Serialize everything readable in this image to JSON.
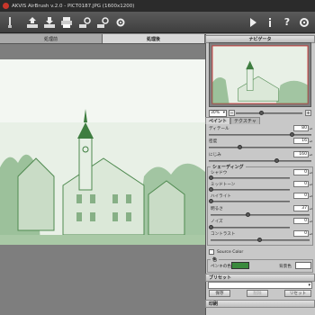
{
  "window": {
    "title": "AKVIS AirBrush v.2.0 - PICT0187.JPG (1600x1200)"
  },
  "toolbar": {
    "buttons": [
      "brush-tool",
      "open",
      "save",
      "print",
      "settings-a",
      "settings-b",
      "settings-c"
    ],
    "right_buttons": [
      "run",
      "about",
      "help",
      "settings"
    ]
  },
  "view_tabs": {
    "before": "処理前",
    "after": "処理後"
  },
  "navigator": {
    "title": "ナビゲータ",
    "zoom": "30%"
  },
  "settings": {
    "tab_paint": "ペイント",
    "tab_texture": "テクスチャ",
    "detail_label": "ディテール",
    "detail_value": "80",
    "density_label": "密度",
    "density_value": "16",
    "blur_label": "にじみ",
    "blur_value": "160",
    "shading_title": "シェーディング",
    "shadow_label": "シャドウ",
    "shadow_value": "0",
    "midtone_label": "ミッドトーン",
    "midtone_value": "0",
    "highlight_label": "ハイライト",
    "highlight_value": "0",
    "brightness_label": "明るさ",
    "brightness_value": "37",
    "noise_label": "ノイズ",
    "noise_value": "0",
    "contrast_label": "コントラスト",
    "contrast_value": "0",
    "source_color_label": "Source Color",
    "color_title": "色",
    "pencil_color_label": "ペンキの色",
    "background_label": "背景色",
    "pencil_color": "#3a8a3d"
  },
  "presets": {
    "title": "プリセット",
    "save": "保存",
    "delete": "削除",
    "reset": "リセット"
  },
  "print": {
    "title": "印刷"
  }
}
